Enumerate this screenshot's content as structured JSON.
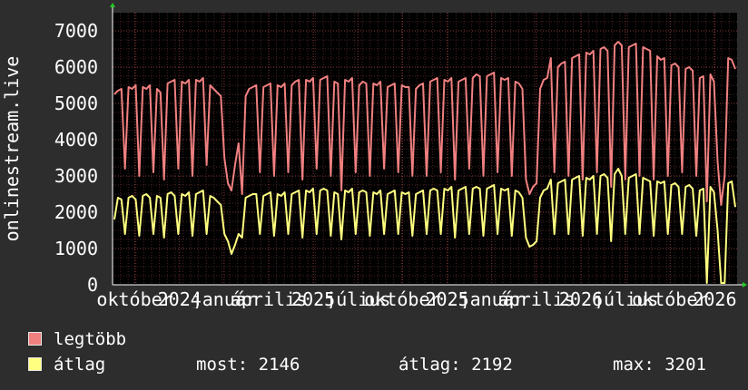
{
  "chart_data": {
    "type": "line",
    "ylabel": "onlinestream.live",
    "ylim": [
      0,
      7500
    ],
    "yticks": [
      0,
      1000,
      2000,
      3000,
      4000,
      5000,
      6000,
      7000
    ],
    "x_tick_labels": [
      "október",
      "2024",
      "január",
      "április",
      "2025",
      "július",
      "október",
      "2025",
      "január",
      "április",
      "2026",
      "július",
      "október",
      "2026"
    ],
    "grid": true,
    "legend_placement": "bottom",
    "series": [
      {
        "name": "legtöbb",
        "color": "#f08080",
        "values": [
          5250,
          5350,
          5400,
          3200,
          5450,
          5400,
          5500,
          3000,
          5450,
          5400,
          5500,
          3100,
          5400,
          5300,
          2900,
          5550,
          5600,
          5650,
          3200,
          5600,
          5550,
          5650,
          3000,
          5650,
          5600,
          5700,
          3300,
          5500,
          5400,
          5300,
          5200,
          3500,
          2800,
          2600,
          3300,
          3900,
          2500,
          5200,
          5400,
          5450,
          5500,
          3100,
          5450,
          5500,
          5550,
          3000,
          5500,
          5450,
          5550,
          3100,
          5500,
          5600,
          5650,
          2900,
          5650,
          5600,
          5700,
          3200,
          5650,
          5700,
          5750,
          3000,
          5600,
          5550,
          2600,
          5650,
          5600,
          5700,
          3100,
          5500,
          5600,
          5550,
          3000,
          5550,
          5500,
          5600,
          3200,
          5450,
          5500,
          5550,
          3100,
          5500,
          5450,
          5450,
          3000,
          5400,
          5500,
          5550,
          3000,
          5600,
          5650,
          5700,
          3100,
          5650,
          5600,
          5700,
          2900,
          5600,
          5650,
          5700,
          3200,
          5700,
          5800,
          5750,
          3000,
          5750,
          5800,
          5850,
          3100,
          5700,
          5650,
          5700,
          3000,
          5600,
          5550,
          5400,
          2900,
          2500,
          2700,
          2800,
          5400,
          5650,
          5700,
          6250,
          3100,
          6000,
          6100,
          6150,
          3000,
          6250,
          6300,
          6350,
          2900,
          6400,
          6350,
          6450,
          3100,
          6500,
          6550,
          6450,
          2700,
          6600,
          6700,
          6600,
          2900,
          6550,
          6600,
          6650,
          3000,
          6550,
          6500,
          6450,
          2900,
          6300,
          6200,
          6250,
          3000,
          6050,
          6100,
          6000,
          3100,
          5950,
          6000,
          5900,
          3000,
          5700,
          5750,
          2300,
          5800,
          5600,
          3400,
          2200,
          3000,
          6250,
          6200,
          5950
        ]
      },
      {
        "name": "átlag",
        "color": "#ffff80",
        "values": [
          1800,
          2400,
          2350,
          1400,
          2400,
          2450,
          2350,
          1350,
          2450,
          2500,
          2400,
          1400,
          2450,
          2400,
          1300,
          2500,
          2550,
          2450,
          1400,
          2500,
          2450,
          2550,
          1350,
          2500,
          2550,
          2600,
          1400,
          2450,
          2400,
          2300,
          2200,
          1400,
          1200,
          850,
          1100,
          1400,
          1300,
          2400,
          2450,
          2500,
          2500,
          1400,
          2450,
          2500,
          2550,
          1350,
          2500,
          2450,
          2550,
          1400,
          2500,
          2550,
          2600,
          1300,
          2600,
          2550,
          2650,
          1400,
          2600,
          2650,
          2600,
          1350,
          2550,
          2500,
          1250,
          2600,
          2550,
          2650,
          1400,
          2550,
          2600,
          2550,
          1350,
          2550,
          2500,
          2600,
          1400,
          2500,
          2550,
          2600,
          1400,
          2550,
          2500,
          2550,
          1350,
          2500,
          2550,
          2600,
          1400,
          2600,
          2650,
          2600,
          1400,
          2650,
          2600,
          2700,
          1300,
          2600,
          2650,
          2700,
          1400,
          2650,
          2700,
          2650,
          1350,
          2650,
          2700,
          2750,
          1400,
          2650,
          2600,
          2650,
          1350,
          2600,
          2550,
          2400,
          1300,
          1050,
          1100,
          1200,
          2400,
          2600,
          2650,
          2900,
          1400,
          2800,
          2850,
          2900,
          1400,
          2900,
          2950,
          3000,
          1350,
          2950,
          2900,
          3000,
          1400,
          3000,
          3050,
          2950,
          1200,
          3050,
          3201,
          3000,
          1400,
          2950,
          3000,
          3050,
          1400,
          2950,
          2900,
          2850,
          1350,
          2850,
          2800,
          2850,
          1400,
          2750,
          2800,
          2700,
          1400,
          2700,
          2750,
          2650,
          1350,
          2600,
          2650,
          50,
          2700,
          2550,
          1500,
          50,
          50,
          2800,
          2850,
          2146
        ]
      }
    ]
  },
  "legend": {
    "items": [
      {
        "label": "legtöbb",
        "color": "#f08080"
      },
      {
        "label": "átlag",
        "color": "#ffff80"
      }
    ],
    "stats": {
      "now_label": "most:",
      "now_value": "2146",
      "avg_label": "átlag:",
      "avg_value": "2192",
      "max_label": "max:",
      "max_value": "3201"
    }
  }
}
